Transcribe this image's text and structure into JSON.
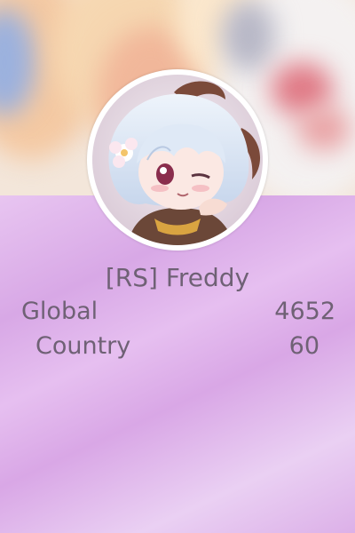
{
  "profile": {
    "username": "[RS] Freddy",
    "avatar": "avatar-image",
    "banner": "banner-image"
  },
  "stats": {
    "global": {
      "label": "Global",
      "value": "4652"
    },
    "country": {
      "label": "Country",
      "value": "60"
    }
  },
  "colors": {
    "text": "#6f6175",
    "panel": "#e4bfee",
    "avatar_border": "#ffffff"
  }
}
